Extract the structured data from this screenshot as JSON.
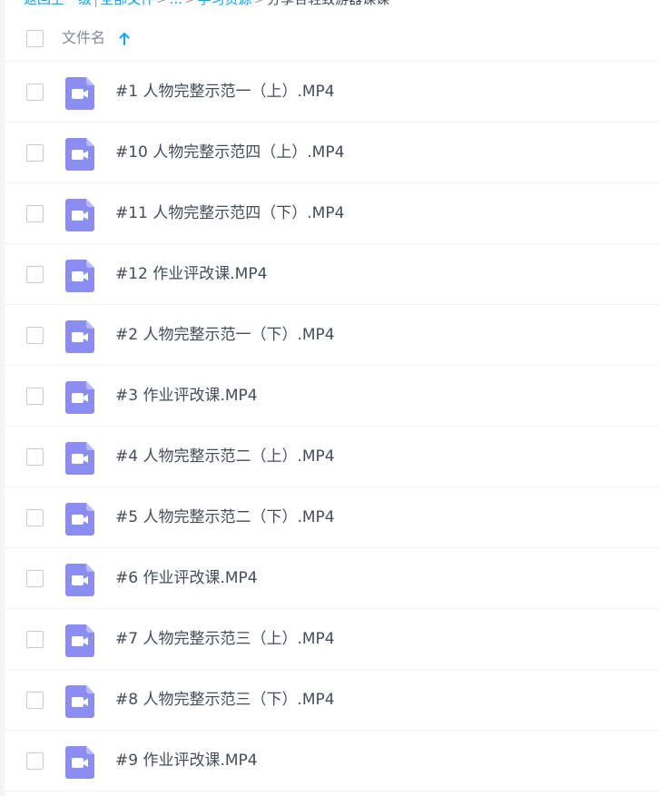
{
  "breadcrumb": {
    "items": [
      "返回上一级",
      "全部文件",
      "...",
      "学习资源",
      "分享合轻致游器课课"
    ]
  },
  "list_header": {
    "column_label": "文件名",
    "sort_icon": "arrow-up-icon",
    "sort_direction": "ascending"
  },
  "files": [
    {
      "name": "#1 人物完整示范一（上）.MP4",
      "icon": "video-file-icon"
    },
    {
      "name": "#10 人物完整示范四（上）.MP4",
      "icon": "video-file-icon"
    },
    {
      "name": "#11 人物完整示范四（下）.MP4",
      "icon": "video-file-icon"
    },
    {
      "name": "#12 作业评改课.MP4",
      "icon": "video-file-icon"
    },
    {
      "name": "#2 人物完整示范一（下）.MP4",
      "icon": "video-file-icon"
    },
    {
      "name": "#3 作业评改课.MP4",
      "icon": "video-file-icon"
    },
    {
      "name": "#4 人物完整示范二（上）.MP4",
      "icon": "video-file-icon"
    },
    {
      "name": "#5 人物完整示范二（下）.MP4",
      "icon": "video-file-icon"
    },
    {
      "name": "#6 作业评改课.MP4",
      "icon": "video-file-icon"
    },
    {
      "name": "#7 人物完整示范三（上）.MP4",
      "icon": "video-file-icon"
    },
    {
      "name": "#8 人物完整示范三（下）.MP4",
      "icon": "video-file-icon"
    },
    {
      "name": "#9 作业评改课.MP4",
      "icon": "video-file-icon"
    }
  ],
  "colors": {
    "accent": "#06a7ff",
    "video_icon": "#8b8df3",
    "text_primary": "#454d5a",
    "text_secondary": "#818999"
  }
}
